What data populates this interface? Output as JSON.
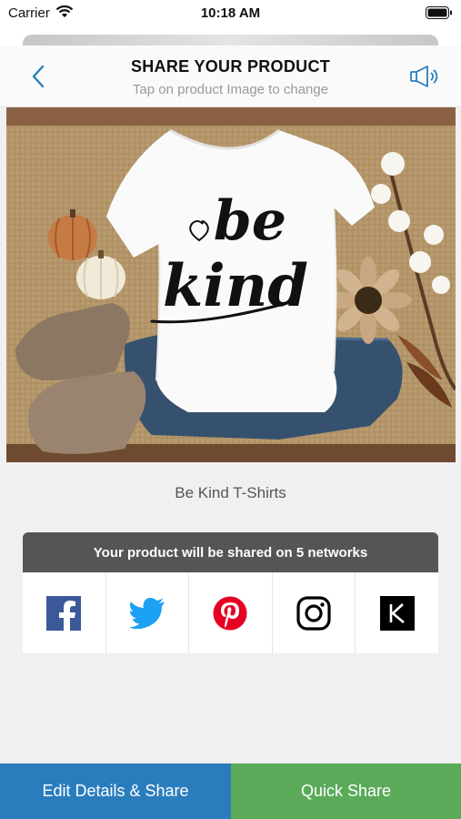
{
  "status_bar": {
    "carrier": "Carrier",
    "time": "10:18 AM"
  },
  "header": {
    "title": "SHARE YOUR PRODUCT",
    "subtitle": "Tap on product Image to change",
    "back_icon": "chevron-left-icon",
    "action_icon": "megaphone-icon"
  },
  "product": {
    "image_text_line1": "be",
    "image_text_line2": "kind",
    "name": "Be Kind T-Shirts"
  },
  "share": {
    "header_text": "Your product will be shared on 5 networks",
    "networks": [
      {
        "name": "Facebook",
        "icon": "facebook-icon",
        "color": "#3b5998"
      },
      {
        "name": "Twitter",
        "icon": "twitter-icon",
        "color": "#1da1f2"
      },
      {
        "name": "Pinterest",
        "icon": "pinterest-icon",
        "color": "#e60023"
      },
      {
        "name": "Instagram",
        "icon": "instagram-icon",
        "color": "#000000"
      },
      {
        "name": "Kickstarter",
        "icon": "k-icon",
        "color": "#000000"
      }
    ]
  },
  "actions": {
    "edit_label": "Edit Details & Share",
    "quick_label": "Quick Share"
  },
  "colors": {
    "accent_blue": "#2a7dbd",
    "accent_green": "#5aaa5a",
    "share_header_bg": "#555555"
  }
}
